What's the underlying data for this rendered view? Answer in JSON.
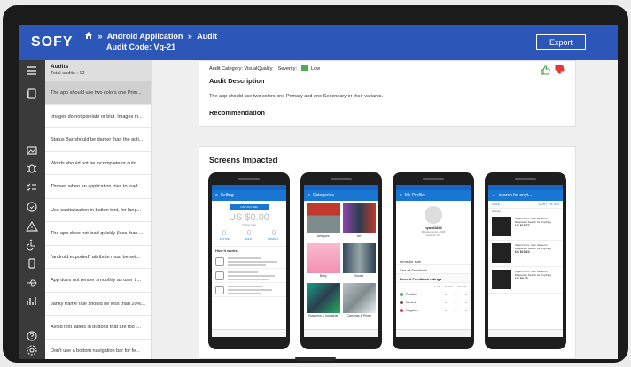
{
  "app": {
    "logo": "SOFY"
  },
  "header": {
    "crumb1": "Android Application",
    "crumb2": "Audit",
    "separator": "»",
    "audit_code": "Audit Code: Vq-21",
    "export_label": "Export"
  },
  "sidebar_icons": [
    "menu-icon",
    "copy-icon",
    "image-icon",
    "bug-icon",
    "checklist-icon",
    "check-circle-icon",
    "warning-icon",
    "accessibility-icon",
    "device-icon",
    "usb-icon",
    "chart-icon",
    "help-icon",
    "settings-icon",
    "user-icon"
  ],
  "audits": {
    "title": "Audits",
    "total": "Total audits : 12",
    "items": [
      "The app should use two colors one Prim...",
      "Images do not pixelate or blur. Images in...",
      "Status Bar should be darker than the acti...",
      "Words should not be incomplete or cuto...",
      "Thrown when an application tries to load...",
      "Use capitalization in button text, for lang...",
      "The app does not load quickly (less than ...",
      "\"android:exported\" attribute must be set...",
      "App does not render smoothly as user tr...",
      "Janky frame rate should be less than 20%...",
      "Avoid text labels in buttons that are too l...",
      "Don't use a bottom navigation bar for fe..."
    ]
  },
  "detail": {
    "category_label": "Audit Category:",
    "category_value": "VisualQuality",
    "severity_label": "Severity:",
    "severity_value": "Low",
    "severity_color": "#4caf50",
    "description_heading": "Audit Description",
    "description_text": "The app should use two colors one Primary and one Secondary or their variants.",
    "recommendation_heading": "Recommendation"
  },
  "screens": {
    "heading": "Screens Impacted",
    "phone1": {
      "title": "Selling",
      "button": "LIST AN ITEM",
      "amount": "US $0.00",
      "amount_sub": "Selling total",
      "counts": [
        "0",
        "0",
        "0"
      ],
      "count_labels": [
        "ACTIVE",
        "SOLD",
        "UNSOLD"
      ],
      "how_title": "How it works"
    },
    "phone2": {
      "title": "Categories",
      "tiles": [
        "Antiques",
        "Art",
        "Baby",
        "Books",
        "Business & Industrial",
        "Cameras & Photo"
      ]
    },
    "phone3": {
      "title": "My Profile",
      "name": "hyuui1844",
      "sub1": "Member since 2018",
      "sub2": "Location US",
      "row1": "Items for sale",
      "row2": "See all Feedback",
      "feedback_title": "Recent Feedback ratings",
      "cols": [
        "1 mth",
        "6 mths",
        "12 mths"
      ],
      "ratings": [
        {
          "label": "Positive",
          "color": "#4caf50"
        },
        {
          "label": "Neutral",
          "color": "#555555"
        },
        {
          "label": "Negative",
          "color": "#e53935"
        }
      ],
      "zeros": "0"
    },
    "phone4": {
      "title": "search for anyt...",
      "save": "SAVE",
      "sort": "SORT",
      "filter": "FILTER",
      "results": "Results",
      "items": [
        {
          "title": "Object Cars - Don Jansen's Desperate Search for Anything",
          "price": "US $18.77"
        },
        {
          "title": "Object Cars - Don Jansen's Desperate Search for Anything",
          "price": "US $19.24"
        },
        {
          "title": "Object Cars - Don Jansen's Desperate Search for Anything",
          "price": "US $9.25"
        }
      ]
    }
  }
}
